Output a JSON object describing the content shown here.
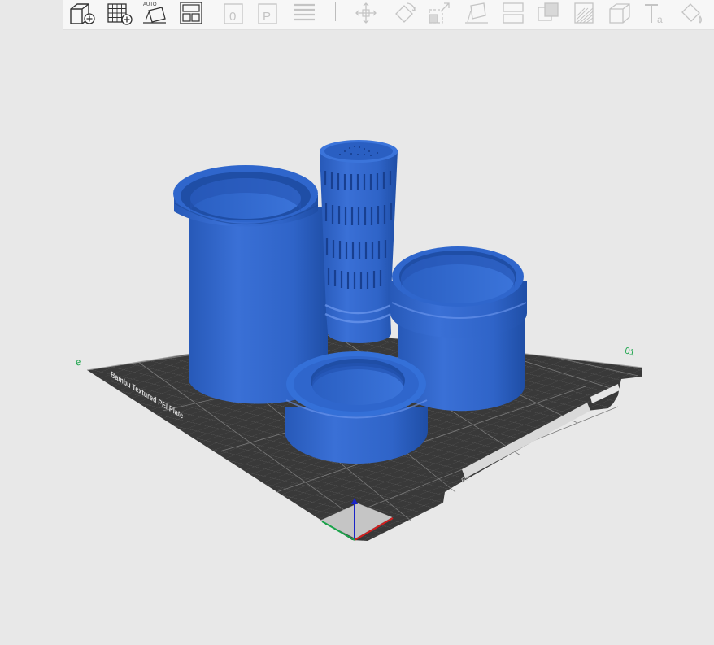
{
  "toolbar": {
    "auto_label": "AUTO",
    "tools": [
      {
        "name": "add-object"
      },
      {
        "name": "add-plate"
      },
      {
        "name": "auto-orient"
      },
      {
        "name": "arrange"
      },
      {
        "name": "slice-plate"
      },
      {
        "name": "print-plate"
      },
      {
        "name": "layers"
      },
      {
        "name": "move"
      },
      {
        "name": "rotate"
      },
      {
        "name": "scale"
      },
      {
        "name": "lay-on-face"
      },
      {
        "name": "cut"
      },
      {
        "name": "boolean"
      },
      {
        "name": "support-painting"
      },
      {
        "name": "seam-painting"
      },
      {
        "name": "text"
      },
      {
        "name": "color-painting"
      }
    ]
  },
  "bed": {
    "brand_text": "Bambu Textured PEI Plate",
    "plate_number": "01",
    "left_marker": "e",
    "corner_label": "B5"
  },
  "colors": {
    "model_blue": "#2d62c4",
    "bed_dark": "#3b3b3b",
    "accent_green": "#1aa34a",
    "background": "#e8e8e8"
  }
}
